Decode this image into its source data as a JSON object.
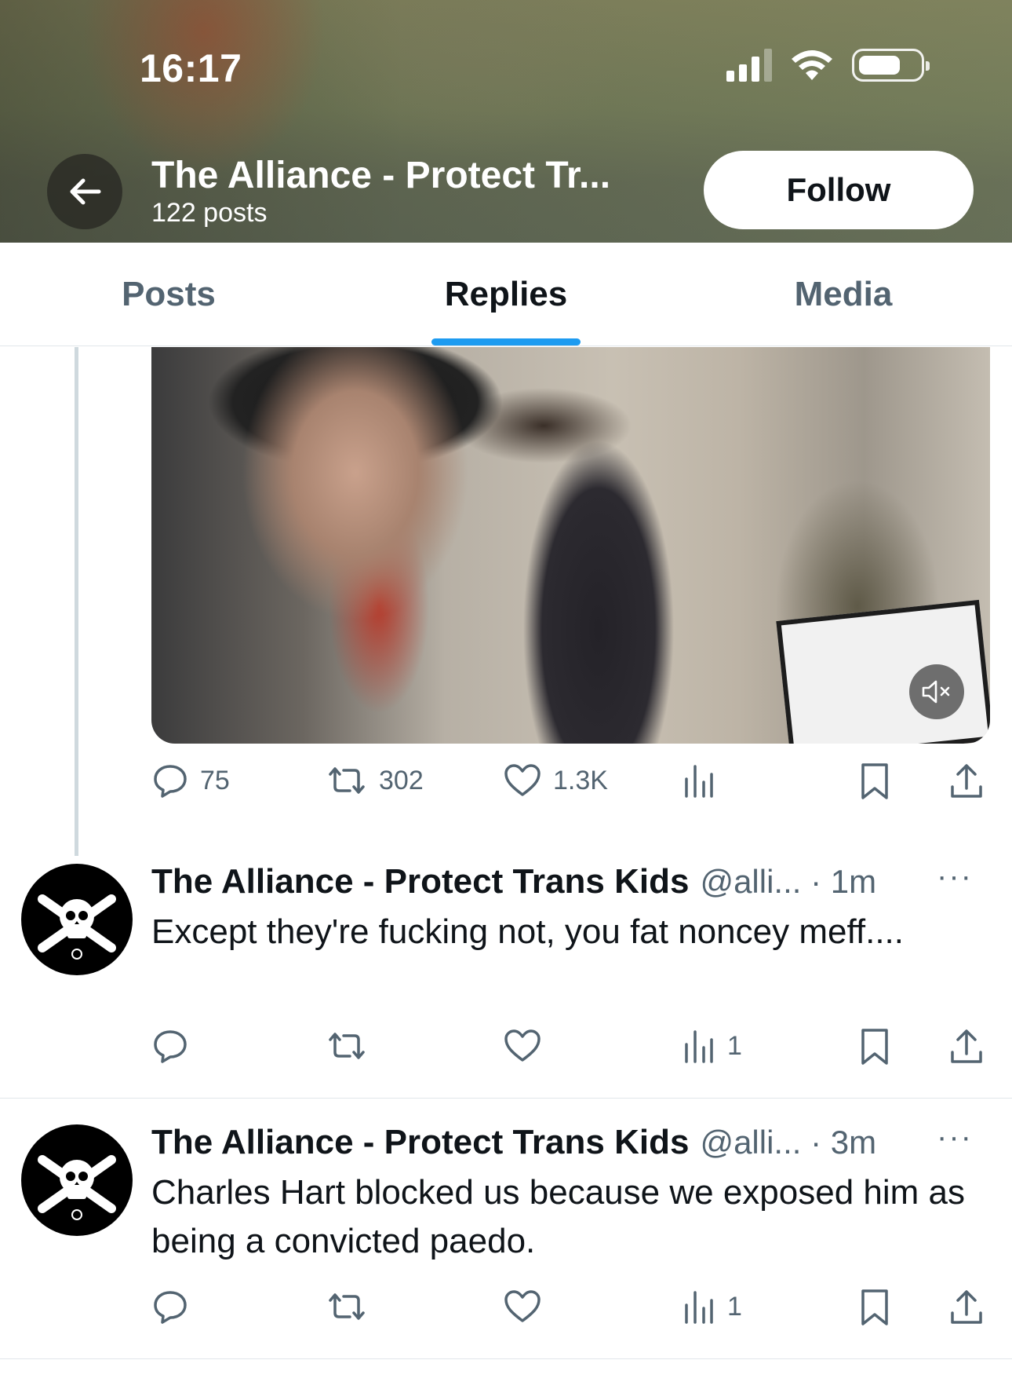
{
  "status_bar": {
    "time": "16:17"
  },
  "header": {
    "profile_name": "The Alliance - Protect Tr...",
    "post_count": "122 posts",
    "follow_label": "Follow"
  },
  "tabs": [
    {
      "label": "Posts",
      "active": false
    },
    {
      "label": "Replies",
      "active": true
    },
    {
      "label": "Media",
      "active": false
    }
  ],
  "video_post": {
    "replies": "75",
    "reposts": "302",
    "likes": "1.3K",
    "views": ""
  },
  "posts": [
    {
      "name": "The Alliance - Protect Trans Kids",
      "handle_time": "@alli... · 1m",
      "text": "Except they're fucking not, you fat noncey meff....",
      "replies": "",
      "reposts": "",
      "likes": "",
      "views": "1"
    },
    {
      "name": "The Alliance - Protect Trans Kids",
      "handle_time": "@alli... · 3m",
      "text": "Charles Hart blocked us because we exposed him as being a convicted paedo.",
      "replies": "",
      "reposts": "",
      "likes": "",
      "views": "1"
    }
  ],
  "more_icon": "···",
  "colors": {
    "accent": "#1d9bf0",
    "muted": "#536471",
    "text": "#0f1419"
  }
}
